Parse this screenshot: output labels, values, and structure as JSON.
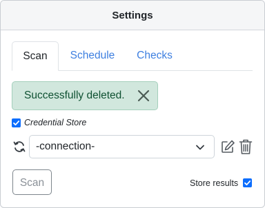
{
  "header": {
    "title": "Settings"
  },
  "tabs": [
    {
      "label": "Scan",
      "active": true
    },
    {
      "label": "Schedule",
      "active": false
    },
    {
      "label": "Checks",
      "active": false
    }
  ],
  "alert": {
    "message": "Successfully deleted.",
    "close_icon": "close-icon"
  },
  "credential_store": {
    "label": "Credential Store",
    "checked": true
  },
  "connection": {
    "selected": "-connection-"
  },
  "actions": {
    "scan_label": "Scan"
  },
  "store_results": {
    "label": "Store results",
    "checked": true
  },
  "colors": {
    "accent": "#0d6efd",
    "link": "#3d7fe0",
    "success_bg": "#d1e7dd",
    "success_text": "#0f5132"
  }
}
